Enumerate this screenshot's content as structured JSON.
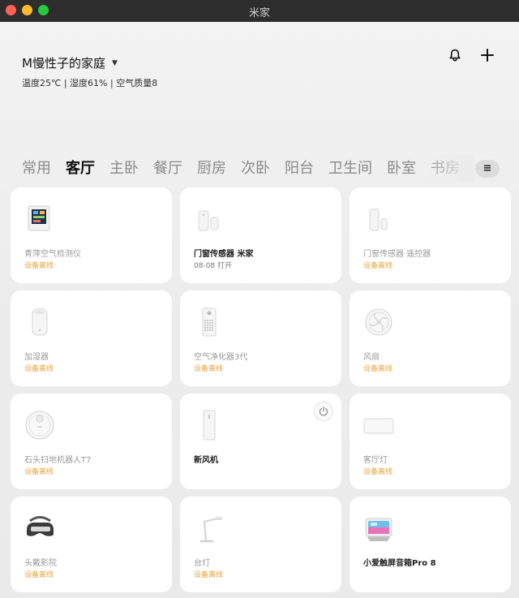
{
  "window": {
    "title": "米家"
  },
  "header": {
    "home_name": "M慢性子的家庭",
    "weather": "温度25℃ | 湿度61% | 空气质量8"
  },
  "tabs": [
    {
      "label": "常用"
    },
    {
      "label": "客厅"
    },
    {
      "label": "主卧"
    },
    {
      "label": "餐厅"
    },
    {
      "label": "厨房"
    },
    {
      "label": "次卧"
    },
    {
      "label": "阳台"
    },
    {
      "label": "卫生间"
    },
    {
      "label": "卧室"
    },
    {
      "label": "书房"
    }
  ],
  "active_tab": "客厅",
  "tab_more_label": "≡",
  "devices": [
    {
      "name": "青萍空气检测仪",
      "status": "设备离线",
      "icon": "air-monitor-icon"
    },
    {
      "name": "门窗传感器 米家",
      "status": "08-08 打开",
      "icon": "door-sensor-icon"
    },
    {
      "name": "门窗传感器 遥控器",
      "status": "设备离线",
      "icon": "door-sensor-remote-icon"
    },
    {
      "name": "加湿器",
      "status": "设备离线",
      "icon": "humidifier-icon"
    },
    {
      "name": "空气净化器3代",
      "status": "设备离线",
      "icon": "air-purifier-icon"
    },
    {
      "name": "风扇",
      "status": "设备离线",
      "icon": "fan-icon"
    },
    {
      "name": "石头扫地机器人T7",
      "status": "设备离线",
      "icon": "robot-vacuum-icon"
    },
    {
      "name": "新风机",
      "status": "",
      "icon": "fresh-air-icon"
    },
    {
      "name": "客厅灯",
      "status": "设备离线",
      "icon": "ceiling-light-icon"
    },
    {
      "name": "头戴影院",
      "status": "设备离线",
      "icon": "vr-headset-icon"
    },
    {
      "name": "台灯",
      "status": "设备离线",
      "icon": "desk-lamp-icon"
    },
    {
      "name": "小爱触屏音箱Pro 8",
      "status": "",
      "icon": "smart-display-icon"
    }
  ],
  "colors": {
    "offline": "#e8a33b",
    "card": "#ffffff",
    "background": "#ececec"
  }
}
